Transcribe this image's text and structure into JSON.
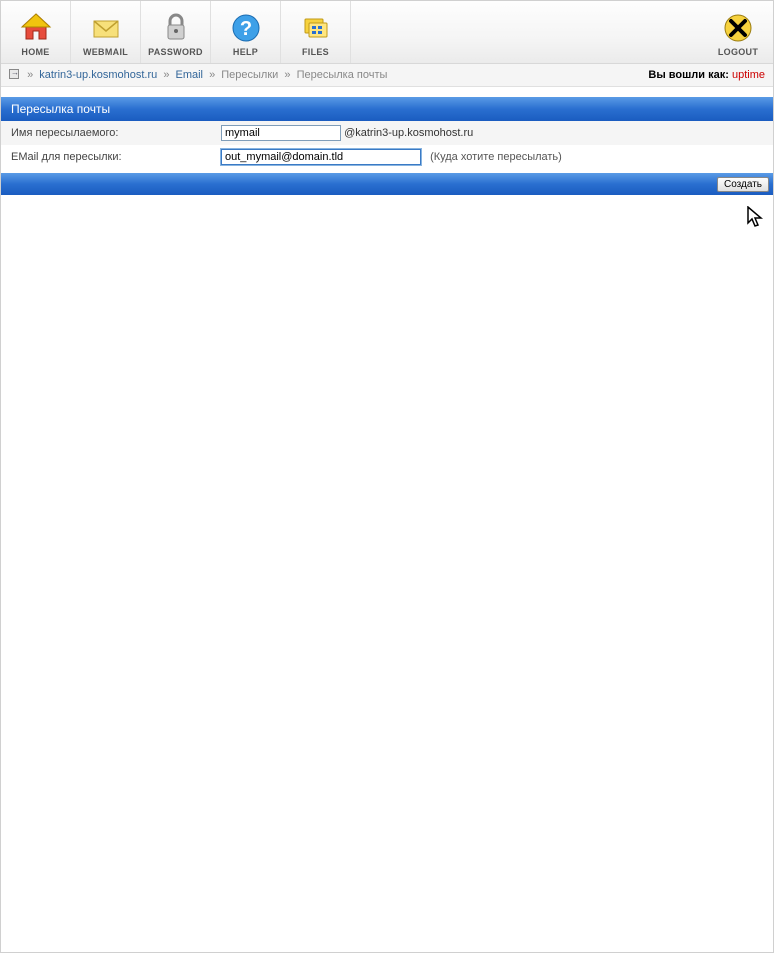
{
  "toolbar": {
    "home": "HOME",
    "webmail": "WEBMAIL",
    "password": "PASSWORD",
    "help": "HELP",
    "files": "FILES",
    "logout": "LOGOUT"
  },
  "breadcrumb": {
    "sep": "»",
    "domain": "katrin3-up.kosmohost.ru",
    "email": "Email",
    "forwards": "Пересылки",
    "current": "Пересылка почты"
  },
  "login": {
    "label": "Вы вошли как:",
    "user": "uptime"
  },
  "page_title": "Пересылка почты",
  "form": {
    "name_label": "Имя пересылаемого:",
    "name_value": "mymail",
    "domain_suffix": "@katrin3-up.kosmohost.ru",
    "email_label": "EMail для пересылки:",
    "email_value": "out_mymail@domain.tld",
    "email_hint": "(Куда хотите пересылать)",
    "submit": "Создать"
  }
}
